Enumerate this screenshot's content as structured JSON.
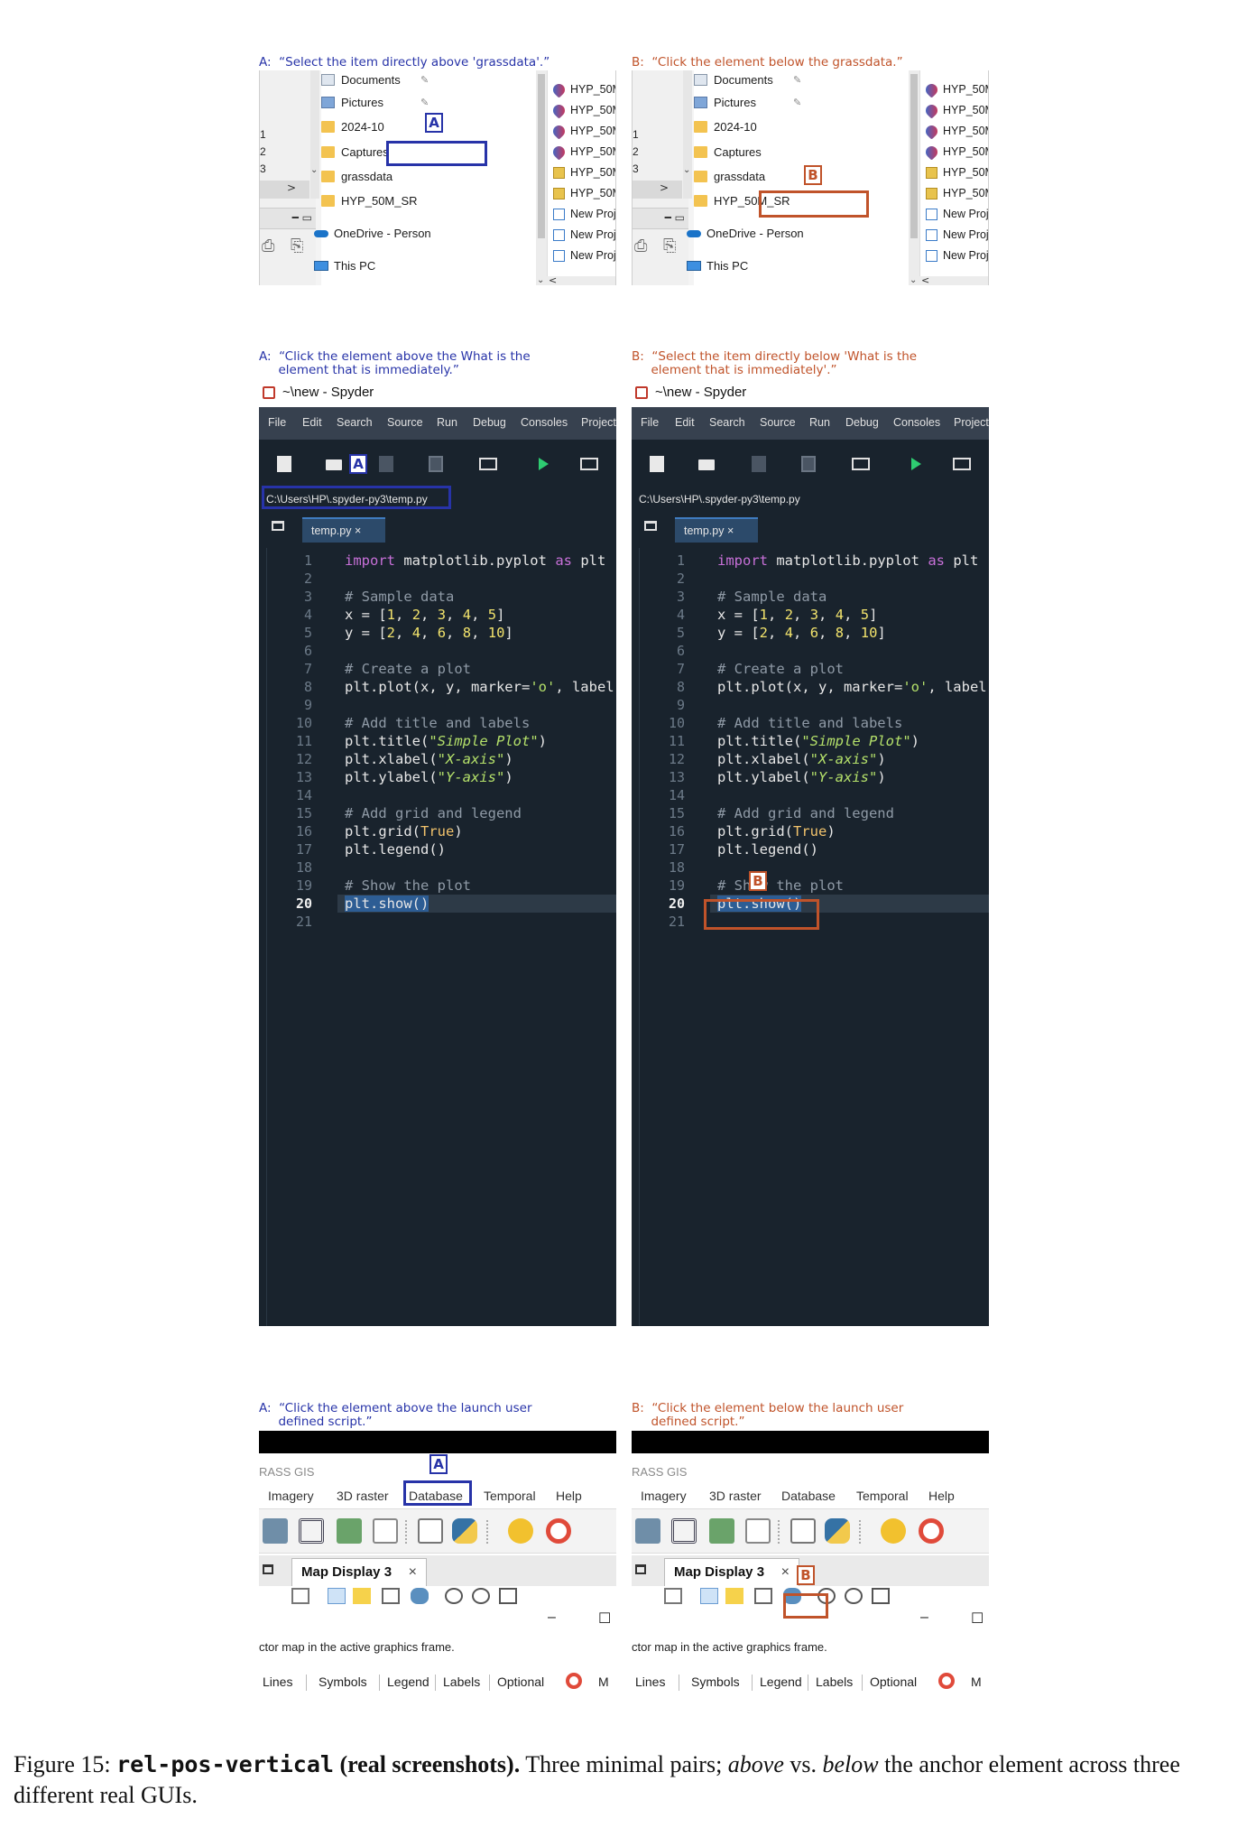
{
  "pairs": [
    {
      "caption_a": "A:  “Select the item directly above 'grassdata'.”",
      "caption_b": "B:  “Click the element below the grassdata.”"
    },
    {
      "caption_a": "A:  “Click the element above the What is the\n     element that is immediately.”",
      "caption_b": "B:  “Select the item directly below 'What is the\n     element that is immediately'.”"
    },
    {
      "caption_a": "A:  “Click the element above the launch user\n     defined script.”",
      "caption_b": "B:  “Click the element below the launch user\n     defined script.”"
    }
  ],
  "markers": {
    "a": "A",
    "b": "B"
  },
  "explorer": {
    "left_numbers": [
      "1",
      "2",
      "3"
    ],
    "items_a": [
      "Documents",
      "Pictures",
      "2024-10",
      "Captures",
      "grassdata",
      "HYP_50M_SR",
      "OneDrive - Person",
      "This PC"
    ],
    "items_b": [
      "Documents",
      "Pictures",
      "2024-10",
      "Captures",
      "grassdata",
      "HYP_50M_SR",
      "OneDrive - Person",
      "This PC"
    ],
    "right_items": [
      "HYP_50M",
      "HYP_50M",
      "HYP_50M",
      "HYP_50M",
      "HYP_50M",
      "HYP_50M",
      "New Proj",
      "New Proj",
      "New Proj"
    ]
  },
  "spyder": {
    "title": "~\\new - Spyder",
    "menu": [
      "File",
      "Edit",
      "Search",
      "Source",
      "Run",
      "Debug",
      "Consoles",
      "Projects"
    ],
    "path": "C:\\Users\\HP\\.spyder-py3\\temp.py",
    "tab": "temp.py",
    "tab_close": "×",
    "current_line": 20,
    "line_count": 21
  },
  "grass": {
    "title": "RASS GIS",
    "menu": [
      "Imagery",
      "3D raster",
      "Database",
      "Temporal",
      "Help"
    ],
    "display_tab": "Map Display 3",
    "display_close": "×",
    "status": "ctor map in the active graphics frame.",
    "bottom_tabs": [
      "Lines",
      "Symbols",
      "Legend",
      "Labels",
      "Optional",
      "M"
    ],
    "minimize": "–",
    "maximize": "☐"
  },
  "figure_caption": {
    "label": "Figure 15: ",
    "code": "rel-pos-vertical",
    "bold": " (real screenshots).",
    "text1": " Three minimal pairs; ",
    "above": "above",
    "vs": " vs. ",
    "below": "below",
    "text2": " the anchor element across three different real GUIs."
  }
}
